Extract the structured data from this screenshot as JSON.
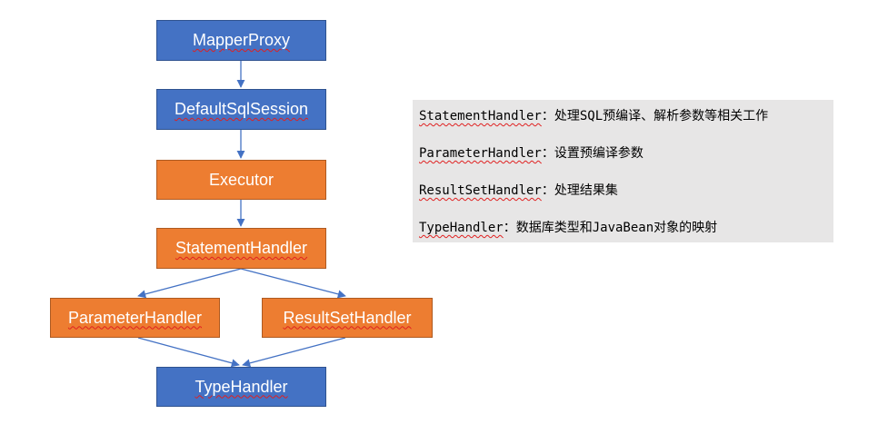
{
  "diagram": {
    "nodes": {
      "mapper_proxy": "MapperProxy",
      "default_sql_session": "DefaultSqlSession",
      "executor": "Executor",
      "statement_handler": "StatementHandler",
      "parameter_handler": "ParameterHandler",
      "result_set_handler": "ResultSetHandler",
      "type_handler": "TypeHandler"
    },
    "colors": {
      "blue": "#4472c4",
      "orange": "#ed7d31",
      "connector": "#4472c4",
      "note_background": "#e7e6e6"
    }
  },
  "notes": [
    {
      "term": "StatementHandler",
      "desc": "：处理SQL预编译、解析参数等相关工作"
    },
    {
      "term": "ParameterHandler",
      "desc": "：设置预编译参数"
    },
    {
      "term": "ResultSetHandler",
      "desc": "：处理结果集"
    },
    {
      "term": "TypeHandler",
      "desc": "：数据库类型和JavaBean对象的映射"
    }
  ]
}
